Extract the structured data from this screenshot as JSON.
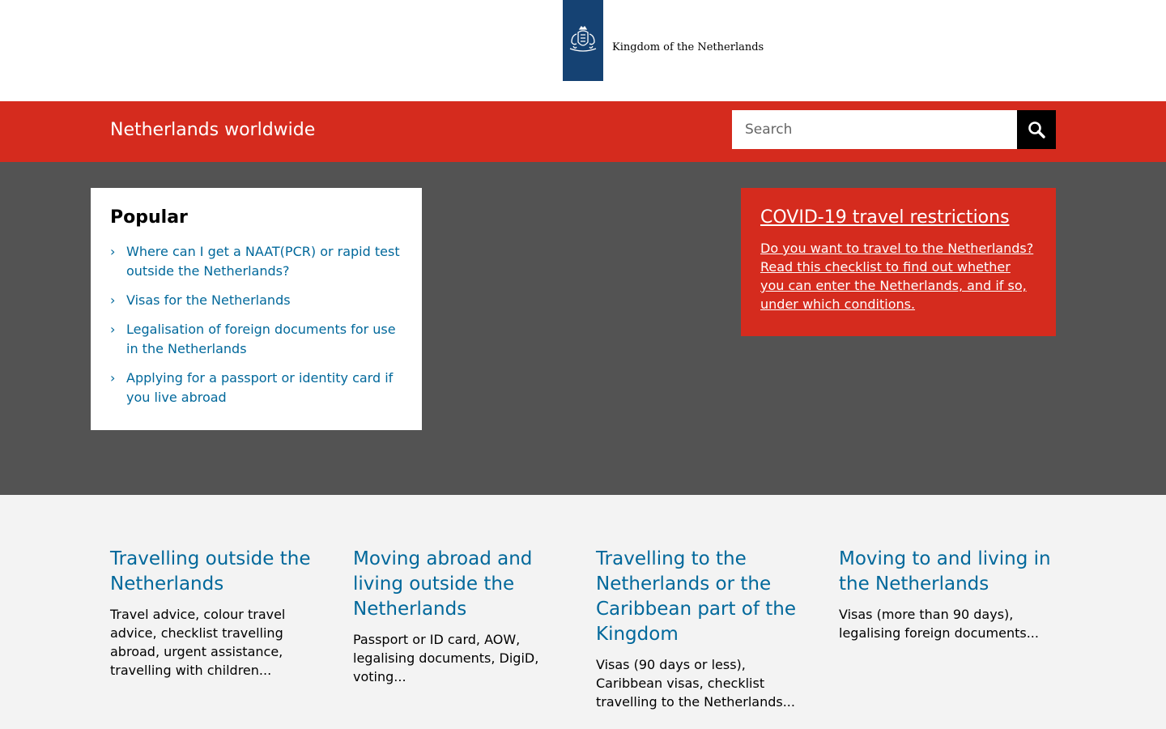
{
  "header": {
    "logo_text": "Kingdom of the Netherlands",
    "logo_icon": "coat-of-arms-icon"
  },
  "band": {
    "site_title": "Netherlands worldwide",
    "search_placeholder": "Search",
    "search_icon": "magnifier-icon"
  },
  "popular": {
    "title": "Popular",
    "items": [
      {
        "label": "Where can I get a NAAT(PCR) or rapid test outside the Netherlands?"
      },
      {
        "label": "Visas for the Netherlands"
      },
      {
        "label": "Legalisation of foreign documents for use in the Netherlands"
      },
      {
        "label": "Applying for a passport or identity card if you live abroad"
      }
    ]
  },
  "covid": {
    "title": "COVID-19 travel restrictions",
    "text": "Do you want to travel to the Netherlands? Read this checklist to find out whether you can enter the Netherlands, and if so, under which conditions."
  },
  "tiles": [
    {
      "title": "Travelling outside the Netherlands",
      "text": "Travel advice, colour travel advice, checklist travelling abroad, urgent assistance, travelling with children..."
    },
    {
      "title": "Moving abroad and living outside the Netherlands",
      "text": "Passport or ID card, AOW, legalising documents, DigiD, voting..."
    },
    {
      "title": "Travelling to the Netherlands or the Caribbean part of the Kingdom",
      "text": "Visas (90 days or less), Caribbean visas, checklist travelling to the Netherlands..."
    },
    {
      "title": "Moving to and living in the Netherlands",
      "text": "Visas (more than 90 days), legalising foreign documents..."
    }
  ],
  "colors": {
    "brand_red": "#d52b1e",
    "logo_blue": "#154273",
    "link_blue": "#01689b",
    "hero_grey": "#535353",
    "bottom_grey": "#f3f3f3"
  }
}
